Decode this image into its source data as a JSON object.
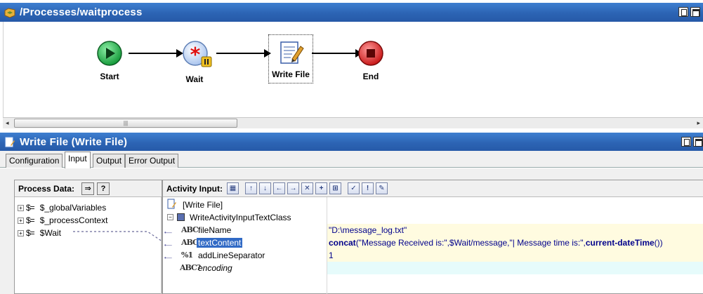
{
  "process_window": {
    "title": "/Processes/waitprocess",
    "nodes": [
      {
        "label": "Start",
        "icon": "start-play-icon"
      },
      {
        "label": "Wait",
        "icon": "wait-asterisk-pause-icon"
      },
      {
        "label": "Write File",
        "icon": "write-file-icon"
      },
      {
        "label": "End",
        "icon": "end-stop-icon"
      }
    ]
  },
  "activity_window": {
    "title": "Write File (Write File)",
    "tabs": [
      "Configuration",
      "Input",
      "Output",
      "Error Output"
    ],
    "active_tab": "Input"
  },
  "process_data": {
    "label": "Process Data:",
    "items": [
      "$_globalVariables",
      "$_processContext",
      "$Wait"
    ]
  },
  "activity_input": {
    "label": "Activity Input:",
    "root": "[Write File]",
    "class_name": "WriteActivityInputTextClass",
    "fields": [
      {
        "name": "fileName",
        "type_icon": "ABC",
        "value": "\"D:\\message_log.txt\""
      },
      {
        "name": "textContent",
        "type_icon": "ABC",
        "value_fn1": "concat",
        "value_mid": "(\"Message Received is:\",$Wait/message,\"| Message time is:\",",
        "value_fn2": "current-dateTime",
        "value_end": "())"
      },
      {
        "name": "addLineSeparator",
        "type_icon": "%1",
        "value": "1"
      },
      {
        "name": "encoding",
        "type_icon": "ABC?",
        "value": ""
      }
    ]
  },
  "colors": {
    "titlebar": "#2c64b4",
    "start": "#22aa44",
    "end": "#d42020",
    "selection": "#316ac5"
  }
}
